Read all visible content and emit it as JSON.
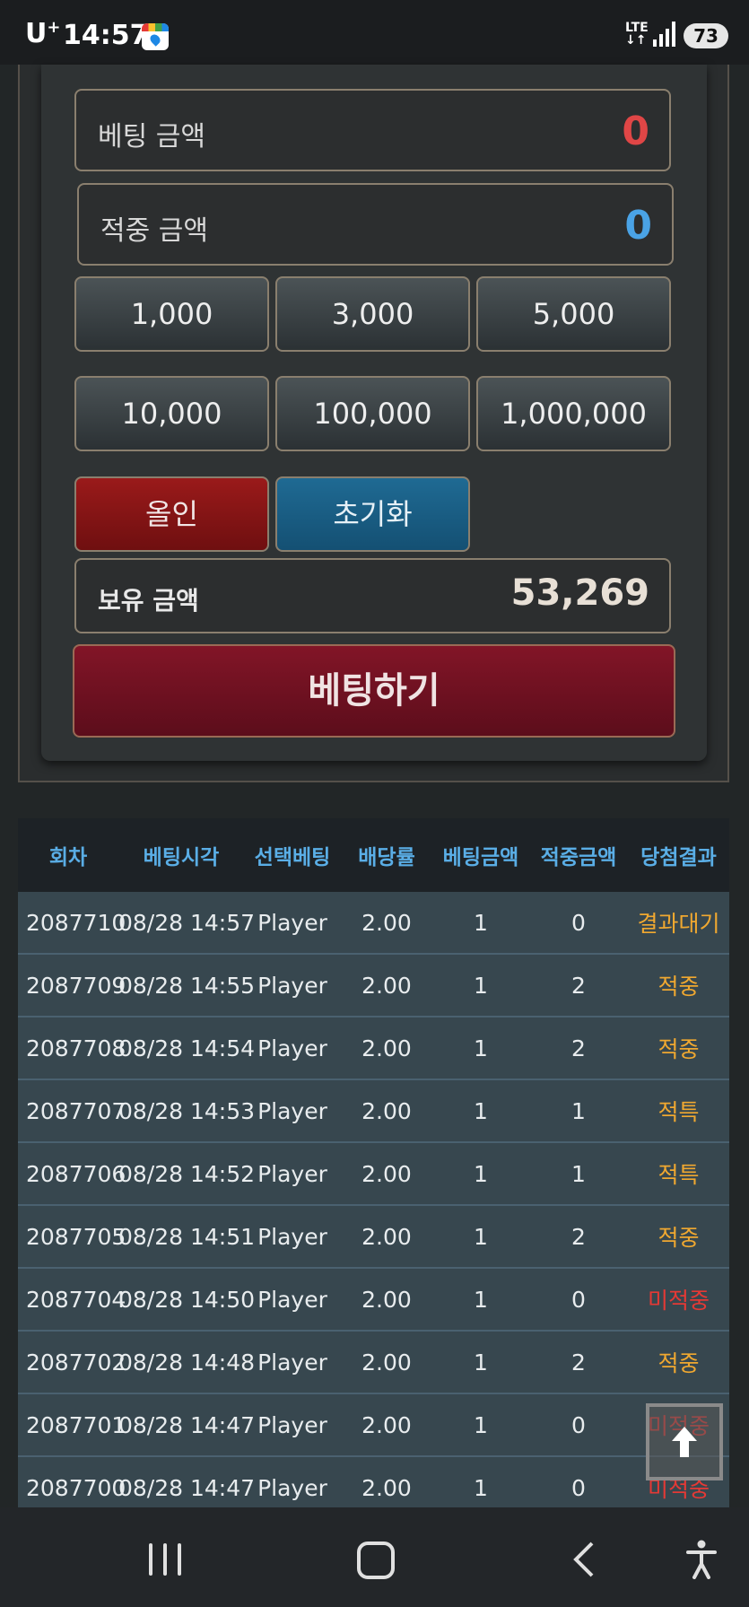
{
  "status_bar": {
    "carrier": "U",
    "carrier_sup": "+",
    "time": "14:57",
    "network": "LTE",
    "battery": "73",
    "app_icon": "map-pin-icon"
  },
  "bet_panel": {
    "bet_amount_label": "베팅 금액",
    "bet_amount_value": "0",
    "win_amount_label": "적중 금액",
    "win_amount_value": "0",
    "chips": [
      "1,000",
      "3,000",
      "5,000",
      "10,000",
      "100,000",
      "1,000,000"
    ],
    "all_in_label": "올인",
    "reset_label": "초기화",
    "holding_label": "보유 금액",
    "holding_value": "53,269",
    "bet_button_label": "베팅하기",
    "colors": {
      "bet_value": "#e04646",
      "win_value": "#4aa3e6"
    }
  },
  "history_table": {
    "headers": [
      "회차",
      "베팅시각",
      "선택베팅",
      "배당률",
      "베팅금액",
      "적중금액",
      "당첨결과"
    ],
    "rows": [
      [
        "2087710",
        "08/28 14:57",
        "Player",
        "2.00",
        "1",
        "0",
        "결과대기"
      ],
      [
        "2087709",
        "08/28 14:55",
        "Player",
        "2.00",
        "1",
        "2",
        "적중"
      ],
      [
        "2087708",
        "08/28 14:54",
        "Player",
        "2.00",
        "1",
        "2",
        "적중"
      ],
      [
        "2087707",
        "08/28 14:53",
        "Player",
        "2.00",
        "1",
        "1",
        "적특"
      ],
      [
        "2087706",
        "08/28 14:52",
        "Player",
        "2.00",
        "1",
        "1",
        "적특"
      ],
      [
        "2087705",
        "08/28 14:51",
        "Player",
        "2.00",
        "1",
        "2",
        "적중"
      ],
      [
        "2087704",
        "08/28 14:50",
        "Player",
        "2.00",
        "1",
        "0",
        "미적중"
      ],
      [
        "2087702",
        "08/28 14:48",
        "Player",
        "2.00",
        "1",
        "2",
        "적중"
      ],
      [
        "2087701",
        "08/28 14:47",
        "Player",
        "2.00",
        "1",
        "0",
        "미적중"
      ],
      [
        "2087700",
        "08/28 14:47",
        "Player",
        "2.00",
        "1",
        "0",
        "미적중"
      ]
    ],
    "result_classes": [
      "res-wait",
      "res-hit",
      "res-hit",
      "res-hit",
      "res-hit",
      "res-hit",
      "res-miss",
      "res-hit",
      "res-miss",
      "res-miss"
    ]
  },
  "scroll_top_icon": "arrow-up-icon",
  "nav_bar": {
    "recent_icon": "recent-apps-icon",
    "home_icon": "home-icon",
    "back_icon": "back-icon",
    "accessibility_icon": "accessibility-icon"
  }
}
